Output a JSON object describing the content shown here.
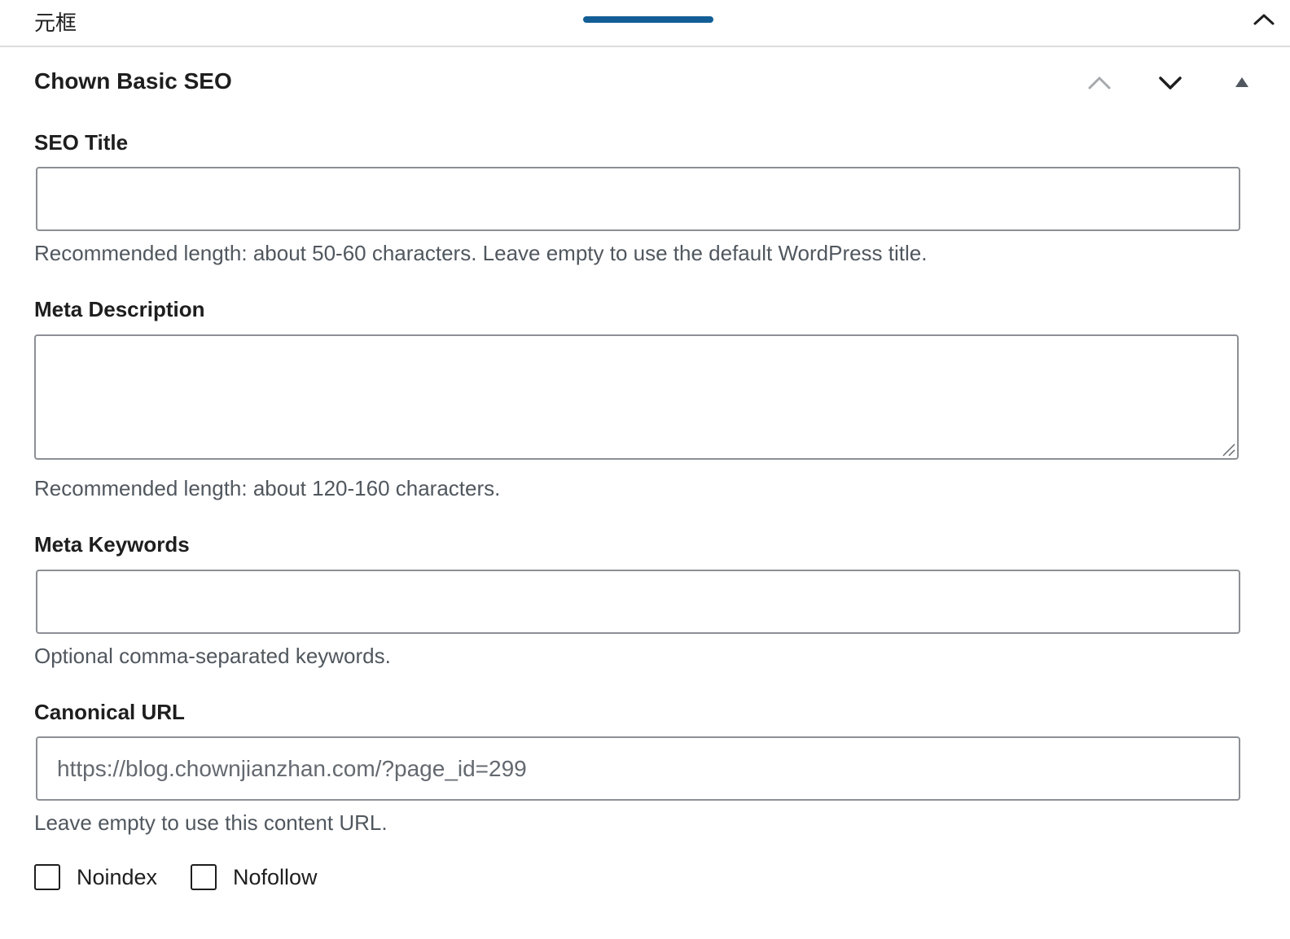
{
  "topbar": {
    "title": "元框",
    "handle_color": "#135e96",
    "collapse_icon": "chevron-up-icon"
  },
  "panel": {
    "title": "Chown Basic SEO",
    "move_up_icon": "chevron-up-icon",
    "move_down_icon": "chevron-down-icon",
    "toggle_icon": "triangle-up-icon"
  },
  "fields": {
    "seo_title": {
      "label": "SEO Title",
      "value": "",
      "placeholder": "",
      "help": "Recommended length: about 50-60 characters. Leave empty to use the default WordPress title."
    },
    "meta_description": {
      "label": "Meta Description",
      "value": "",
      "help": "Recommended length: about 120-160 characters."
    },
    "meta_keywords": {
      "label": "Meta Keywords",
      "value": "",
      "placeholder": "",
      "help": "Optional comma-separated keywords."
    },
    "canonical_url": {
      "label": "Canonical URL",
      "value": "",
      "placeholder": "https://blog.chownjianzhan.com/?page_id=299",
      "help": "Leave empty to use this content URL."
    }
  },
  "checkboxes": {
    "noindex": {
      "label": "Noindex",
      "checked": false
    },
    "nofollow": {
      "label": "Nofollow",
      "checked": false
    }
  },
  "colors": {
    "accent": "#135e96",
    "border": "#8c8f94",
    "help_text": "#50575e"
  }
}
